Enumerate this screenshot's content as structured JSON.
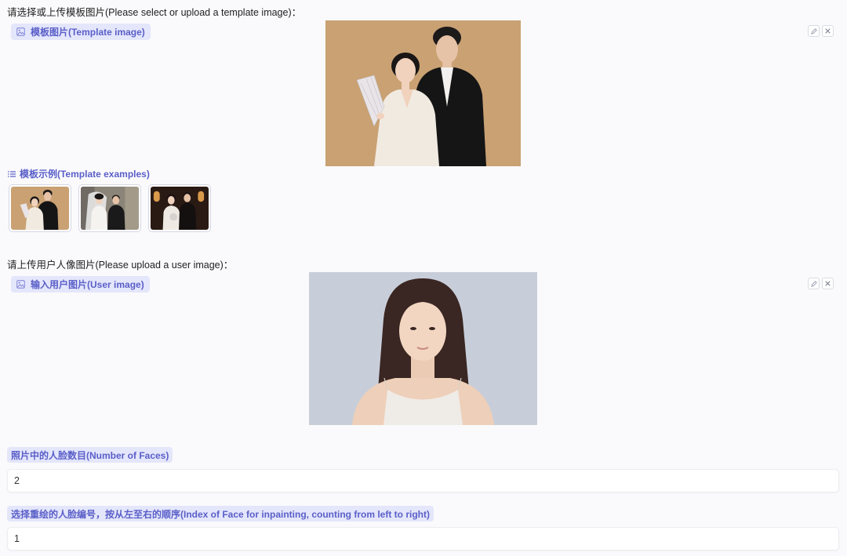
{
  "template_section": {
    "prompt": "请选择或上传模板图片(Please select or upload a template image)：",
    "chip_label": "模板图片(Template image)",
    "chip_icon": "image-icon",
    "edit_icon": "pencil-icon",
    "clear_icon": "close-icon",
    "examples_label": "模板示例(Template examples)",
    "examples_icon": "list-icon",
    "examples": [
      "wedding-couple-fan-beige",
      "wedding-couple-veil-church",
      "wedding-couple-dark-interior"
    ]
  },
  "user_section": {
    "prompt": "请上传用户人像图片(Please upload a user image)：",
    "chip_label": "输入用户图片(User image)",
    "chip_icon": "image-icon",
    "edit_icon": "pencil-icon",
    "clear_icon": "close-icon"
  },
  "fields": {
    "num_faces_label": "照片中的人脸数目(Number of Faces)",
    "num_faces_value": "2",
    "face_index_label": "选择重绘的人脸编号，按从左至右的顺序(Index of Face for inpainting, counting from left to right)",
    "face_index_value": "1"
  },
  "colors": {
    "accent": "#5a5fc8",
    "chip_bg": "#e4e6fb",
    "background": "#fafafc"
  }
}
